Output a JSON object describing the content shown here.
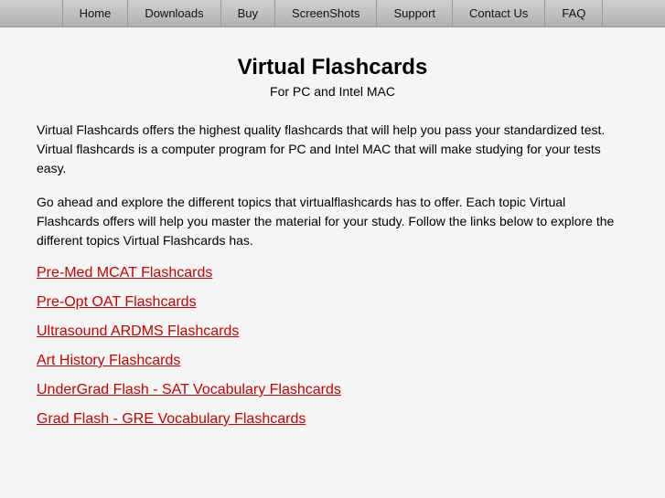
{
  "nav": {
    "items": [
      {
        "label": "Home",
        "name": "nav-home"
      },
      {
        "label": "Downloads",
        "name": "nav-downloads"
      },
      {
        "label": "Buy",
        "name": "nav-buy"
      },
      {
        "label": "ScreenShots",
        "name": "nav-screenshots"
      },
      {
        "label": "Support",
        "name": "nav-support"
      },
      {
        "label": "Contact Us",
        "name": "nav-contact"
      },
      {
        "label": "FAQ",
        "name": "nav-faq"
      }
    ]
  },
  "header": {
    "title": "Virtual Flashcards",
    "subtitle": "For PC and Intel MAC"
  },
  "content": {
    "paragraph1": "Virtual Flashcards offers the highest quality flashcards that will help you pass your standardized test. Virtual flashcards is a computer program for PC and Intel MAC that will make studying for your tests easy.",
    "paragraph2": "Go ahead and explore the different topics that virtualflashcards has to offer. Each topic Virtual Flashcards offers will help you master the material for your study. Follow the links below to explore the different topics Virtual Flashcards has."
  },
  "links": [
    {
      "label": "Pre-Med MCAT Flashcards",
      "name": "link-mcat"
    },
    {
      "label": "Pre-Opt OAT Flashcards",
      "name": "link-oat"
    },
    {
      "label": "Ultrasound ARDMS Flashcards",
      "name": "link-ardms"
    },
    {
      "label": "Art History Flashcards",
      "name": "link-art-history"
    },
    {
      "label": "UnderGrad Flash - SAT Vocabulary Flashcards",
      "name": "link-sat"
    },
    {
      "label": "Grad Flash - GRE Vocabulary Flashcards",
      "name": "link-gre"
    }
  ]
}
